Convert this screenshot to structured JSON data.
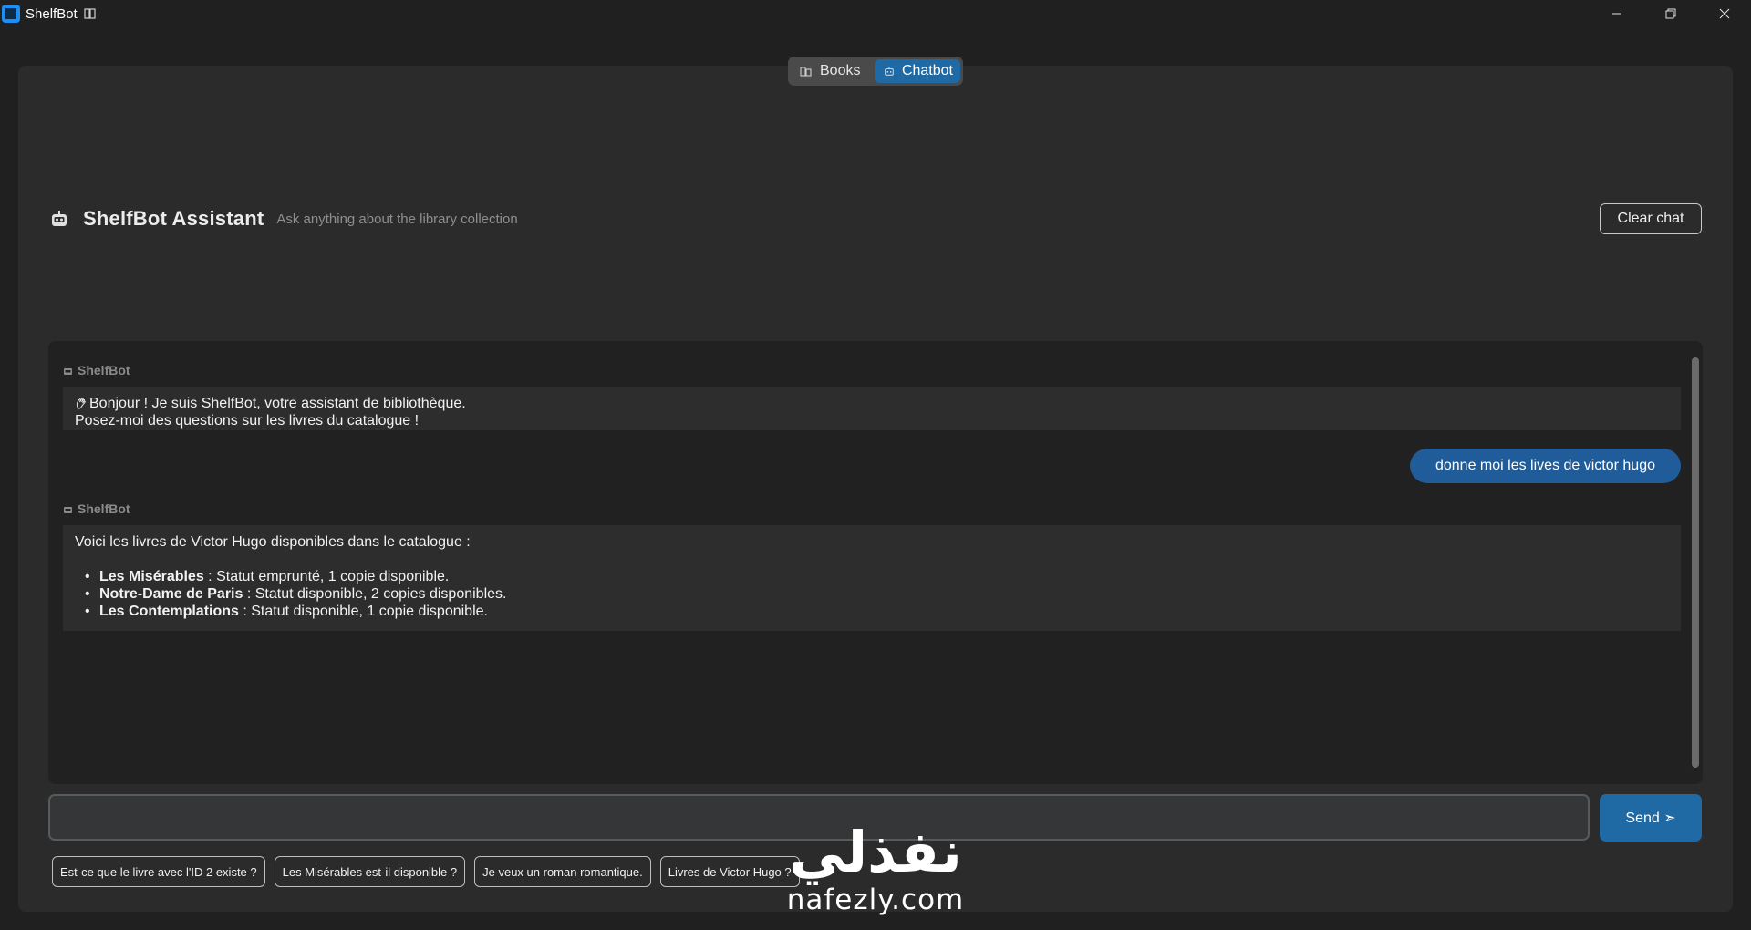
{
  "window": {
    "title": "ShelfBot",
    "title_icon": "book-icon",
    "controls": [
      "minimize-icon",
      "restore-icon",
      "close-icon"
    ]
  },
  "nav": {
    "tabs": [
      {
        "label": "Books",
        "icon": "books-icon",
        "active": false
      },
      {
        "label": "Chatbot",
        "icon": "robot-icon",
        "active": true
      }
    ]
  },
  "header": {
    "icon": "robot-icon",
    "title": "ShelfBot Assistant",
    "subtitle": "Ask anything about the library collection",
    "clear_label": "Clear chat"
  },
  "chat": {
    "messages": [
      {
        "role": "bot",
        "sender": "ShelfBot",
        "lines": [
          "Bonjour ! Je suis ShelfBot, votre assistant de bibliothèque.",
          "Posez-moi des questions sur les livres du catalogue !"
        ],
        "leading_icon": "waving-hand-icon"
      },
      {
        "role": "user",
        "text": "donne moi les lives de victor hugo"
      },
      {
        "role": "bot",
        "sender": "ShelfBot",
        "intro": "Voici les livres de Victor Hugo disponibles dans le catalogue :",
        "items": [
          {
            "title": "Les Misérables",
            "detail": " : Statut emprunté, 1 copie disponible."
          },
          {
            "title": "Notre-Dame de Paris",
            "detail": " : Statut disponible, 2 copies disponibles."
          },
          {
            "title": "Les Contemplations",
            "detail": " : Statut disponible, 1 copie disponible."
          }
        ]
      }
    ]
  },
  "input": {
    "value": "",
    "placeholder": "",
    "send_label": "Send ➣"
  },
  "suggestions": [
    "Est-ce que le livre avec l'ID 2 existe ?",
    "Les Misérables est-il disponible ?",
    "Je veux un roman romantique.",
    "Livres de Victor Hugo ?"
  ],
  "watermark": {
    "arabic": "نفذلي",
    "latin": "nafezly.com"
  },
  "colors": {
    "background": "#202020",
    "panel": "#2b2b2b",
    "chat_area": "#212121",
    "bot_bubble": "#2d2d2d",
    "user_bubble": "#1f5c99",
    "accent": "#1f6aa5",
    "muted_text": "#8f8f8f"
  }
}
